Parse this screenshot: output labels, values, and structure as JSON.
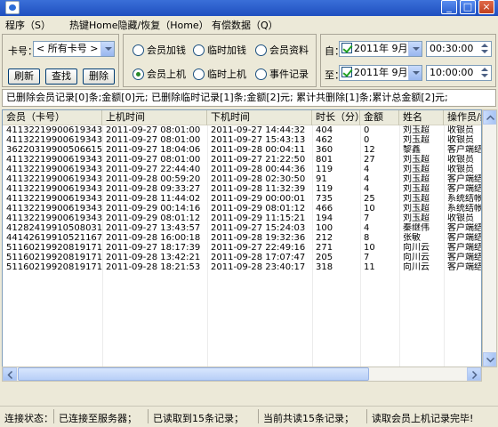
{
  "window": {
    "close_glyph": "×",
    "min_glyph": "_",
    "max_glyph": "□",
    "restore_glyph": "▫"
  },
  "menu": [
    "程序（S）",
    "热键Home隐藏/恢复（Home）",
    "有偿数据（Q）"
  ],
  "card": {
    "label": "卡号：",
    "selected": "< 所有卡号 >",
    "refresh": "刷新",
    "search": "查找",
    "delete": "删除"
  },
  "radios": [
    {
      "label": "会员加钱",
      "checked": false
    },
    {
      "label": "临时加钱",
      "checked": false
    },
    {
      "label": "会员资料",
      "checked": false
    },
    {
      "label": "会员上机",
      "checked": true
    },
    {
      "label": "临时上机",
      "checked": false
    },
    {
      "label": "事件记录",
      "checked": false
    }
  ],
  "date_from": {
    "label": "自：",
    "date": "2011年 9月27日",
    "time": "00:30:00",
    "checked": true
  },
  "date_to": {
    "label": "至：",
    "date": "2011年 9月29日",
    "time": "10:00:00",
    "checked": true
  },
  "summary": "已删除会员记录[0]条;金额[0]元; 已删除临时记录[1]条;金额[2]元; 累计共删除[1]条;累计总金额[2]元;",
  "columns": [
    "会员（卡号）",
    "上机时间",
    "下机时间",
    "时长（分）",
    "金额",
    "姓名",
    "操作员/结帐"
  ],
  "rows": [
    [
      "411322199006193433",
      "2011-09-27 08:01:00",
      "2011-09-27 14:44:32",
      "404",
      "0",
      "刘玉超",
      "收银员"
    ],
    [
      "411322199006193433",
      "2011-09-27 08:01:00",
      "2011-09-27 15:43:13",
      "462",
      "0",
      "刘玉超",
      "收银员"
    ],
    [
      "362203199005066151",
      "2011-09-27 18:04:06",
      "2011-09-28 00:04:11",
      "360",
      "12",
      "黎鑫",
      "客户端结帐"
    ],
    [
      "411322199006193433",
      "2011-09-27 08:01:00",
      "2011-09-27 21:22:50",
      "801",
      "27",
      "刘玉超",
      "收银员"
    ],
    [
      "411322199006193433",
      "2011-09-27 22:44:40",
      "2011-09-28 00:44:36",
      "119",
      "4",
      "刘玉超",
      "收银员"
    ],
    [
      "411322199006193433",
      "2011-09-28 00:59:20",
      "2011-09-28 02:30:50",
      "91",
      "4",
      "刘玉超",
      "客户端结帐"
    ],
    [
      "411322199006193433",
      "2011-09-28 09:33:27",
      "2011-09-28 11:32:39",
      "119",
      "4",
      "刘玉超",
      "客户端结帐"
    ],
    [
      "411322199006193433",
      "2011-09-28 11:44:02",
      "2011-09-29 00:00:01",
      "735",
      "25",
      "刘玉超",
      "系统结帐(零"
    ],
    [
      "411322199006193433",
      "2011-09-29 00:14:16",
      "2011-09-29 08:01:12",
      "466",
      "10",
      "刘玉超",
      "系统结帐X"
    ],
    [
      "411322199006193433",
      "2011-09-29 08:01:12",
      "2011-09-29 11:15:21",
      "194",
      "7",
      "刘玉超",
      "收银员"
    ],
    [
      "412824199105080312",
      "2011-09-27 13:43:57",
      "2011-09-27 15:24:03",
      "100",
      "4",
      "秦继伟",
      "客户端结帐"
    ],
    [
      "441426199105211672",
      "2011-09-28 16:00:18",
      "2011-09-28 19:32:36",
      "212",
      "8",
      "张敏",
      "客户端结帐"
    ],
    [
      "511602199208191713",
      "2011-09-27 18:17:39",
      "2011-09-27 22:49:16",
      "271",
      "10",
      "向川云",
      "客户端结帐"
    ],
    [
      "511602199208191713",
      "2011-09-28 13:42:21",
      "2011-09-28 17:07:47",
      "205",
      "7",
      "向川云",
      "客户端结帐"
    ],
    [
      "511602199208191713",
      "2011-09-28 18:21:53",
      "2011-09-28 23:40:17",
      "318",
      "11",
      "向川云",
      "客户端结帐"
    ]
  ],
  "status": {
    "connect_label": "连接状态：",
    "connect_value": "已连接至服务器；",
    "received": "已读取到15条记录；",
    "total": "当前共读15条记录；",
    "done": "读取会员上机记录完毕!"
  }
}
